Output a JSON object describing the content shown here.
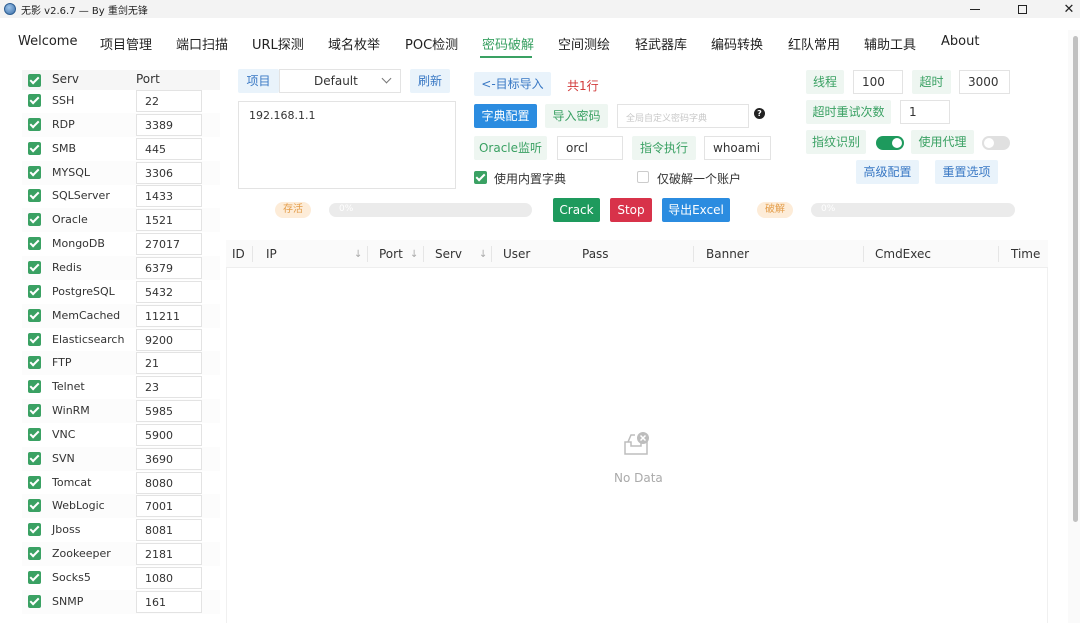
{
  "window": {
    "title": "无影 v2.6.7 — By 重剑无锋"
  },
  "menu": {
    "items": [
      "Welcome",
      "项目管理",
      "端口扫描",
      "URL探测",
      "域名枚举",
      "POC检测",
      "密码破解",
      "空间测绘",
      "轻武器库",
      "编码转换",
      "红队常用",
      "辅助工具",
      "About"
    ],
    "active": "密码破解"
  },
  "services": {
    "header_serv": "Serv",
    "header_port": "Port",
    "rows": [
      {
        "name": "SSH",
        "port": "22"
      },
      {
        "name": "RDP",
        "port": "3389"
      },
      {
        "name": "SMB",
        "port": "445"
      },
      {
        "name": "MYSQL",
        "port": "3306"
      },
      {
        "name": "SQLServer",
        "port": "1433"
      },
      {
        "name": "Oracle",
        "port": "1521"
      },
      {
        "name": "MongoDB",
        "port": "27017"
      },
      {
        "name": "Redis",
        "port": "6379"
      },
      {
        "name": "PostgreSQL",
        "port": "5432"
      },
      {
        "name": "MemCached",
        "port": "11211"
      },
      {
        "name": "Elasticsearch",
        "port": "9200"
      },
      {
        "name": "FTP",
        "port": "21"
      },
      {
        "name": "Telnet",
        "port": "23"
      },
      {
        "name": "WinRM",
        "port": "5985"
      },
      {
        "name": "VNC",
        "port": "5900"
      },
      {
        "name": "SVN",
        "port": "3690"
      },
      {
        "name": "Tomcat",
        "port": "8080"
      },
      {
        "name": "WebLogic",
        "port": "7001"
      },
      {
        "name": "Jboss",
        "port": "8081"
      },
      {
        "name": "Zookeeper",
        "port": "2181"
      },
      {
        "name": "Socks5",
        "port": "1080"
      },
      {
        "name": "SNMP",
        "port": "161"
      }
    ]
  },
  "controls": {
    "project_label": "项目",
    "project_value": "Default",
    "refresh": "刷新",
    "targets_text": "192.168.1.1",
    "import_targets": "<-目标导入",
    "row_count": "共1行",
    "dict_config": "字典配置",
    "import_password": "导入密码",
    "custom_dict_placeholder": "全局自定义密码字典",
    "oracle_listen": "Oracle监听",
    "oracle_value": "orcl",
    "cmd_exec": "指令执行",
    "cmd_value": "whoami",
    "use_builtin_dict": "使用内置字典",
    "crack_one_only": "仅破解一个账户",
    "threads_label": "线程",
    "threads_value": "100",
    "timeout_label": "超时",
    "timeout_value": "3000",
    "retry_label": "超时重试次数",
    "retry_value": "1",
    "fingerprint": "指纹识别",
    "use_proxy": "使用代理",
    "advanced": "高级配置",
    "reset": "重置选项",
    "survive_tag": "存活",
    "survive_progress": "0%",
    "crack_btn": "Crack",
    "stop_btn": "Stop",
    "export_btn": "导出Excel",
    "crack_tag": "破解",
    "crack_progress": "0%"
  },
  "table": {
    "columns": [
      "ID",
      "IP",
      "Port",
      "Serv",
      "User",
      "Pass",
      "Banner",
      "CmdExec",
      "Time"
    ],
    "empty_text": "No Data"
  },
  "colors": {
    "accent_green": "#3aa163",
    "blue": "#2b8ce0",
    "red": "#d8324a"
  }
}
